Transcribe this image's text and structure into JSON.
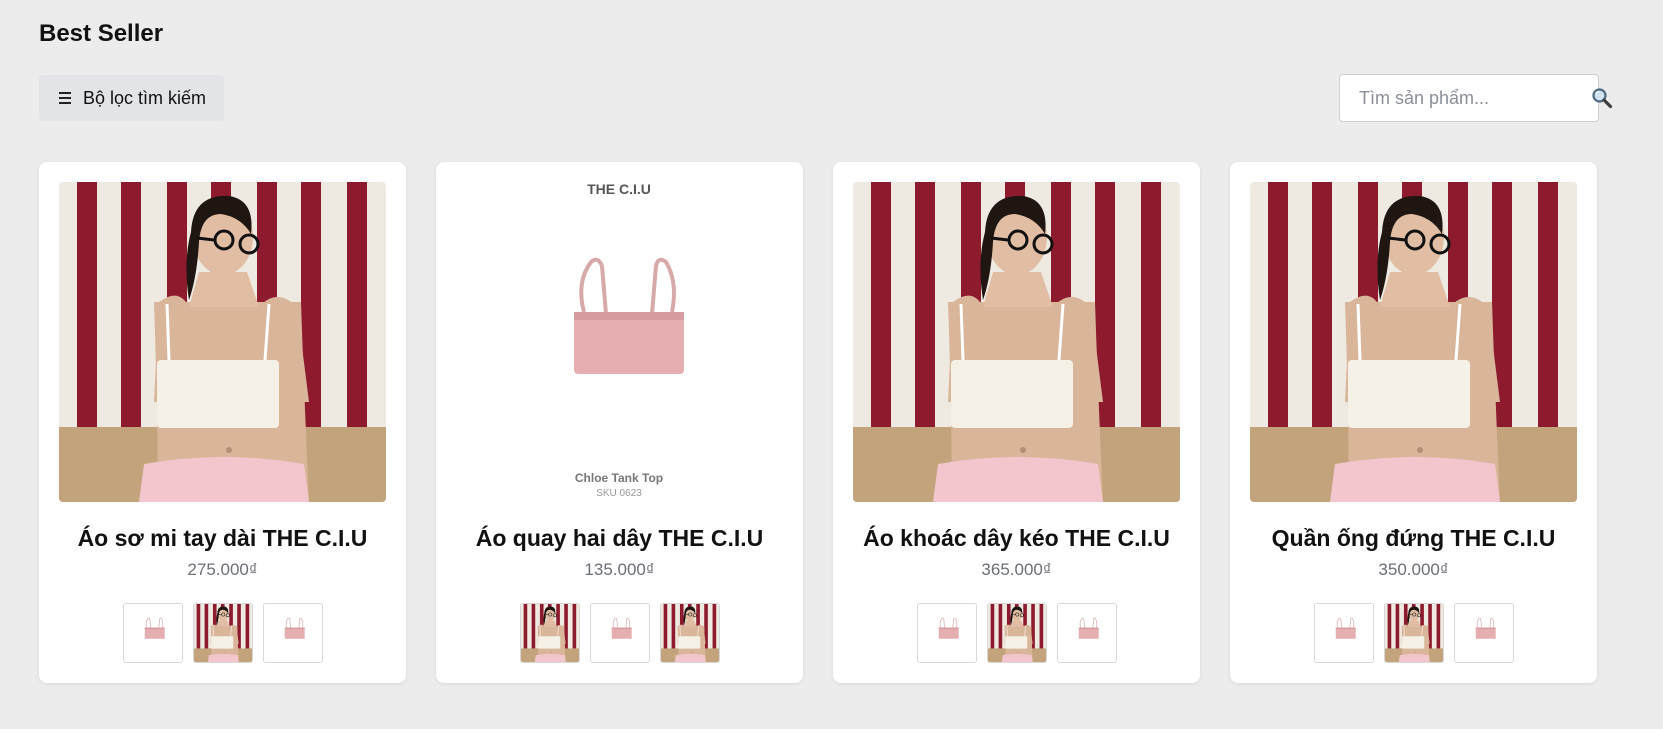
{
  "section": {
    "title": "Best Seller"
  },
  "filter": {
    "label": "Bộ lọc tìm kiếm",
    "icon": "menu-icon"
  },
  "search": {
    "placeholder": "Tìm sản phẩm...",
    "icon": "search-icon"
  },
  "colors": {
    "background": "#ececec",
    "card": "#ffffff",
    "filter_bg": "#e3e4e8",
    "price": "#6b6f76",
    "stripe_red": "#8e1a2e",
    "top_pink": "#e2a9ad"
  },
  "products": [
    {
      "name": "Áo sơ mi tay dài THE C.I.U",
      "price": "275.000₫",
      "image": "model-photo",
      "thumbs": [
        "flatlay-photo",
        "model-photo",
        "flatlay-photo"
      ]
    },
    {
      "name": "Áo quay hai dây THE C.I.U",
      "price": "135.000₫",
      "image": "flatlay-photo",
      "image_caption": {
        "brand": "THE C.I.U",
        "label": "Chloe Tank Top",
        "sub": "SKU 0623"
      },
      "thumbs": [
        "model-photo",
        "flatlay-photo",
        "model-photo"
      ]
    },
    {
      "name": "Áo khoác dây kéo THE C.I.U",
      "price": "365.000₫",
      "image": "model-photo",
      "thumbs": [
        "flatlay-photo",
        "model-photo",
        "flatlay-photo"
      ]
    },
    {
      "name": "Quần ống đứng THE C.I.U",
      "price": "350.000₫",
      "image": "model-photo",
      "thumbs": [
        "flatlay-photo",
        "model-photo",
        "flatlay-photo"
      ]
    }
  ]
}
